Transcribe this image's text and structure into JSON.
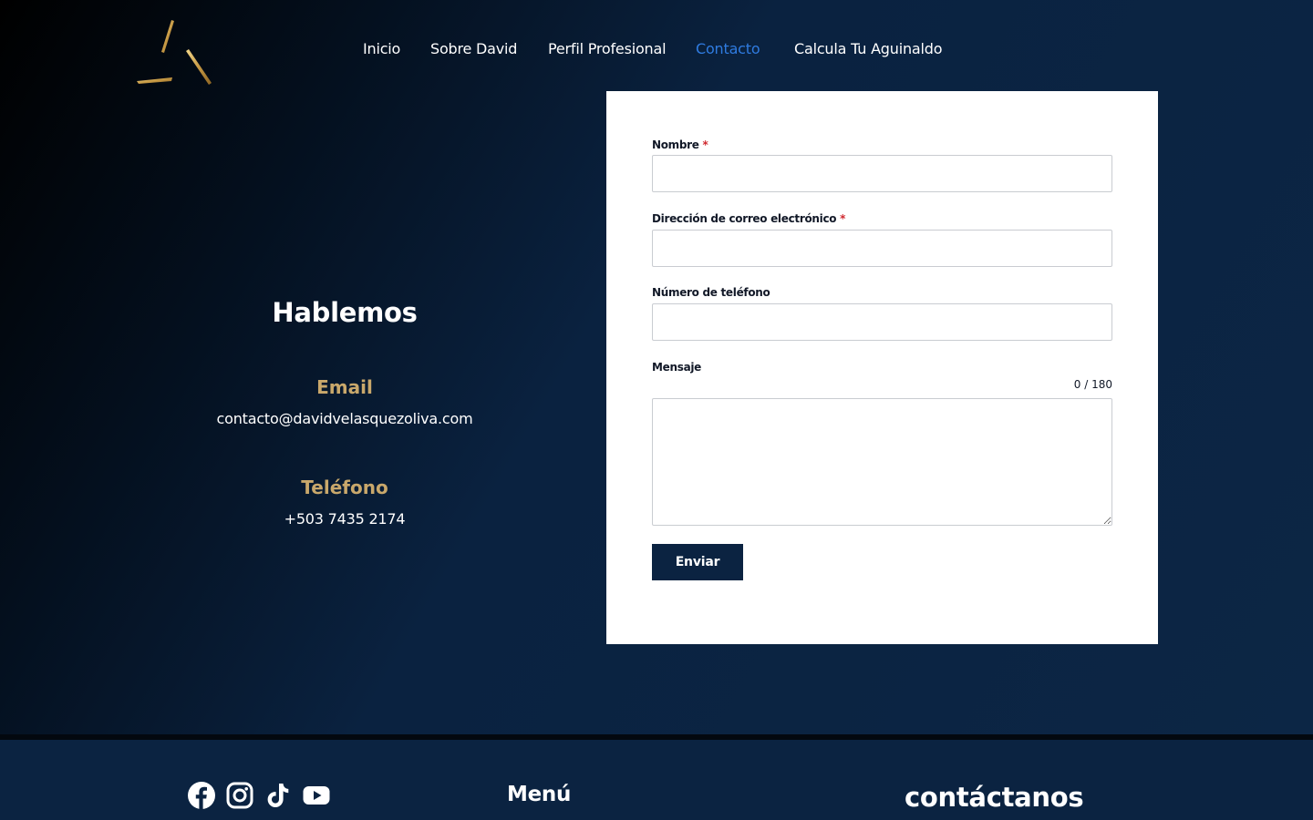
{
  "nav": {
    "items": [
      {
        "label": "Inicio",
        "active": false
      },
      {
        "label": "Sobre David",
        "active": false
      },
      {
        "label": "Perfil Profesional",
        "active": false
      },
      {
        "label": "Contacto",
        "active": true
      },
      {
        "label": "Calcula Tu Aguinaldo",
        "active": false
      }
    ]
  },
  "contact_info": {
    "heading": "Hablemos",
    "email_label": "Email",
    "email_value": "contacto@davidvelasquezoliva.com",
    "phone_label": "Teléfono",
    "phone_value": "+503 7435 2174"
  },
  "form": {
    "name_label": "Nombre",
    "name_required": "*",
    "name_value": "",
    "email_label": "Dirección de correo electrónico",
    "email_required": "*",
    "email_value": "",
    "phone_label": "Número de teléfono",
    "phone_value": "",
    "message_label": "Mensaje",
    "message_counter": "0 / 180",
    "message_value": "",
    "submit_label": "Enviar"
  },
  "footer": {
    "social": [
      "facebook-icon",
      "instagram-icon",
      "tiktok-icon",
      "youtube-icon"
    ],
    "menu_heading": "Menú",
    "contact_heading": "contáctanos"
  },
  "colors": {
    "background": "#0b2341",
    "gold": "#c9a86b",
    "nav_active": "#2f7be0",
    "button": "#0b2341",
    "required": "#d0292f"
  }
}
